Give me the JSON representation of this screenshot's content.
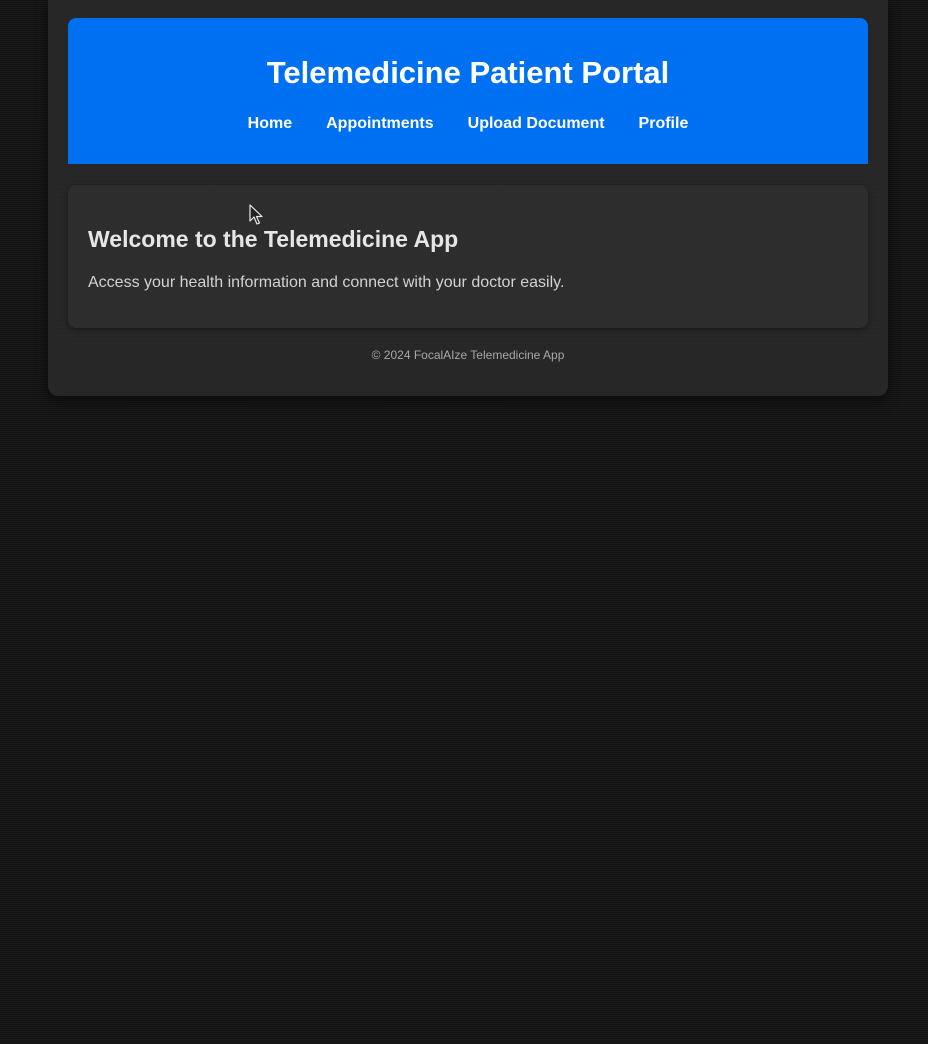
{
  "header": {
    "title": "Telemedicine Patient Portal",
    "nav": [
      {
        "label": "Home"
      },
      {
        "label": "Appointments"
      },
      {
        "label": "Upload Document"
      },
      {
        "label": "Profile"
      }
    ]
  },
  "main": {
    "welcome_title": "Welcome to the Telemedicine App",
    "welcome_text": "Access your health information and connect with your doctor easily."
  },
  "footer": {
    "text": "© 2024 FocalAIze Telemedicine App"
  },
  "icons": {
    "cursor": "mouse-pointer-icon"
  },
  "colors": {
    "accent": "#0070f3",
    "background": "#141414",
    "card": "#2c2c2c"
  }
}
